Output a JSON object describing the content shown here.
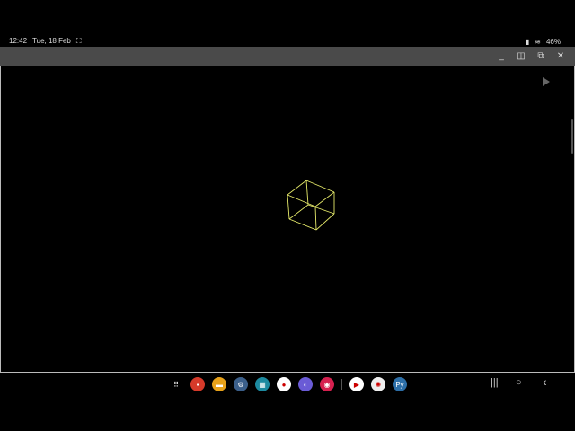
{
  "status_bar": {
    "time": "12:42",
    "date": "Tue, 18 Feb",
    "battery": "46%"
  },
  "window_controls": {
    "minimize": "_",
    "split": "◫",
    "popup": "⧉",
    "close": "✕"
  },
  "taskbar": {
    "apps": [
      {
        "name": "app-drawer",
        "glyph": "⠿",
        "color": "#000000"
      },
      {
        "name": "samsung-notes",
        "glyph": "▪",
        "color": "#d63a2a"
      },
      {
        "name": "my-files",
        "glyph": "▬",
        "color": "#e8a21a"
      },
      {
        "name": "settings",
        "glyph": "⚙",
        "color": "#3b5f8a"
      },
      {
        "name": "calendar",
        "glyph": "▦",
        "color": "#1d8aa0"
      },
      {
        "name": "messages",
        "glyph": "●",
        "color": "#ffffff"
      },
      {
        "name": "internet",
        "glyph": "◐",
        "color": "#6a5bd6"
      },
      {
        "name": "camera",
        "glyph": "◉",
        "color": "#d6204f"
      },
      {
        "name": "youtube",
        "glyph": "▶",
        "color": "#ffffff"
      },
      {
        "name": "chatgpt",
        "glyph": "✺",
        "color": "#eeeeee"
      },
      {
        "name": "pydroid",
        "glyph": "Py",
        "color": "#2d6fa8"
      }
    ]
  },
  "nav": {
    "recents": "|||",
    "home": "○",
    "back": "‹"
  },
  "accent": {
    "cube": "#e6ea6a"
  }
}
